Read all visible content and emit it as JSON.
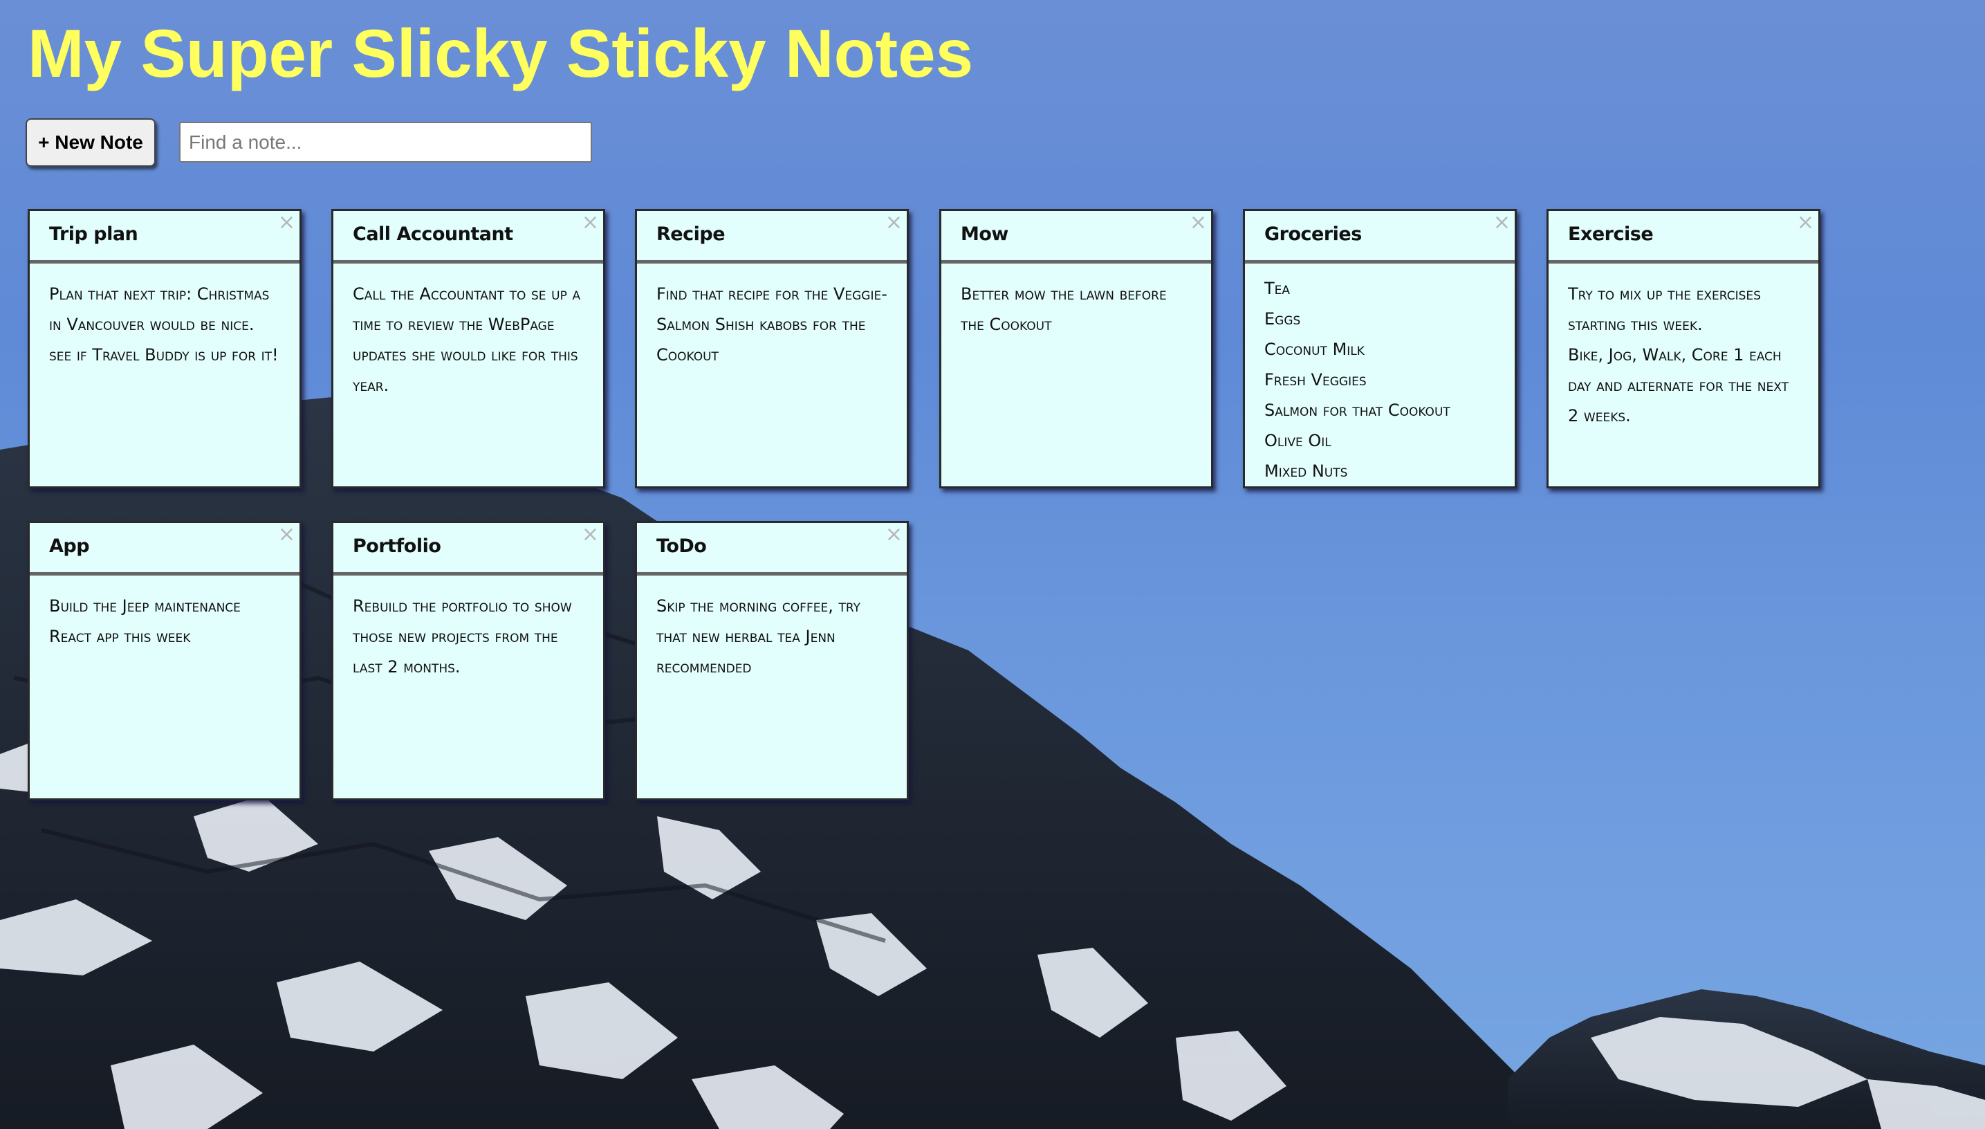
{
  "app": {
    "title": "My Super Slicky Sticky Notes"
  },
  "toolbar": {
    "new_note_label": "+ New Note",
    "search_placeholder": "Find a note...",
    "search_value": ""
  },
  "notes": [
    {
      "title": "Trip plan",
      "close": "×",
      "lines": [
        "Plan that next trip: Christmas in Vancouver would be nice.",
        "see if Travel Buddy is up for it!"
      ]
    },
    {
      "title": "Call Accountant",
      "close": "×",
      "lines": [
        "Call the Accountant to se up a time to review the WebPage updates she would like for this year."
      ]
    },
    {
      "title": "Recipe",
      "close": "×",
      "lines": [
        "Find that recipe for the Veggie-Salmon Shish kabobs for the Cookout"
      ]
    },
    {
      "title": "Mow",
      "close": "×",
      "lines": [
        "Better mow the lawn before the Cookout"
      ]
    },
    {
      "title": "Groceries",
      "close": "×",
      "lines": [
        "Tea",
        "Eggs",
        "Coconut Milk",
        "Fresh Veggies",
        "Salmon for that Cookout",
        "Olive Oil",
        "Mixed Nuts"
      ]
    },
    {
      "title": "Exercise",
      "close": "×",
      "lines": [
        "Try to mix up the exercises starting this week.",
        "Bike, Jog, Walk, Core 1 each day and alternate for the next 2 weeks."
      ]
    },
    {
      "title": "App",
      "close": "×",
      "lines": [
        "Build the Jeep maintenance React app this week"
      ]
    },
    {
      "title": "Portfolio",
      "close": "×",
      "lines": [
        "Rebuild the portfolio to show those new projects from the last 2 months."
      ]
    },
    {
      "title": "ToDo",
      "close": "×",
      "lines": [
        "Skip the morning coffee, try that new herbal tea Jenn recommended"
      ]
    }
  ],
  "colors": {
    "title": "#ffff5e",
    "note_bg": "#e2fffd",
    "sky": "#6a8fd6"
  },
  "icons": {
    "note_close": "close-icon"
  }
}
